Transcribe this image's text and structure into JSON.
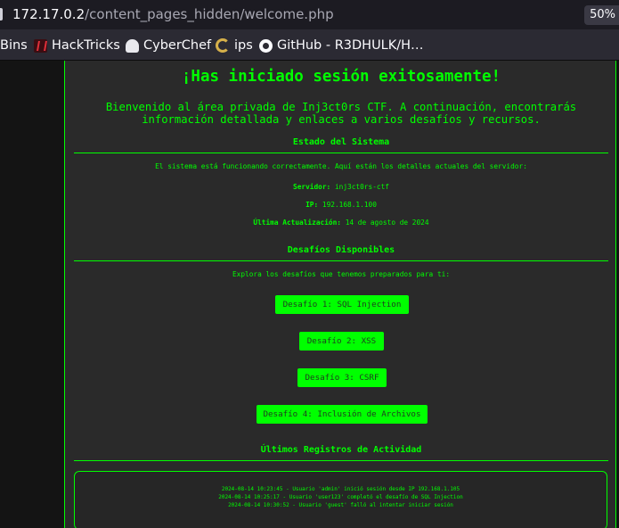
{
  "browser": {
    "url_host": "172.17.0.2",
    "url_path": "/content_pages_hidden/welcome.php",
    "zoom": "50%",
    "bookmarks": [
      {
        "label": "Bins",
        "icon": "none"
      },
      {
        "label": "HackTricks",
        "icon": "hacktricks-icon"
      },
      {
        "label": "CyberChef",
        "icon": "cyberchef-icon"
      },
      {
        "label": "ips",
        "icon": "ips-icon"
      },
      {
        "label": "GitHub - R3DHULK/H…",
        "icon": "github-icon"
      }
    ]
  },
  "page": {
    "title": "¡Has iniciado sesión exitosamente!",
    "intro": "Bienvenido al área privada de Inj3ct0rs CTF. A continuación, encontrarás información detallada y enlaces a varios desafíos y recursos.",
    "status": {
      "heading": "Estado del Sistema",
      "text": "El sistema está funcionando correctamente. Aquí están los detalles actuales del servidor:",
      "server_label": "Servidor:",
      "server_value": "inj3ct0rs-ctf",
      "ip_label": "IP:",
      "ip_value": "192.168.1.100",
      "updated_label": "Última Actualización:",
      "updated_value": "14 de agosto de 2024"
    },
    "challenges": {
      "heading": "Desafíos Disponibles",
      "text": "Explora los desafíos que tenemos preparados para ti:",
      "buttons": [
        "Desafío 1: SQL Injection",
        "Desafío 2: XSS",
        "Desafío 3: CSRF",
        "Desafío 4: Inclusión de Archivos"
      ]
    },
    "logs": {
      "heading": "Últimos Registros de Actividad",
      "lines": [
        "2024-08-14 10:23:45 - Usuario 'admin' inició sesión desde IP 192.168.1.105",
        "2024-08-14 10:25:17 - Usuario 'user123' completó el desafío de SQL Injection",
        "2024-08-14 10:30:52 - Usuario 'guest' falló al intentar iniciar sesión"
      ]
    }
  },
  "colors": {
    "accent": "#00ff00",
    "panel_bg": "#2a2a2a",
    "page_bg": "#121212"
  }
}
